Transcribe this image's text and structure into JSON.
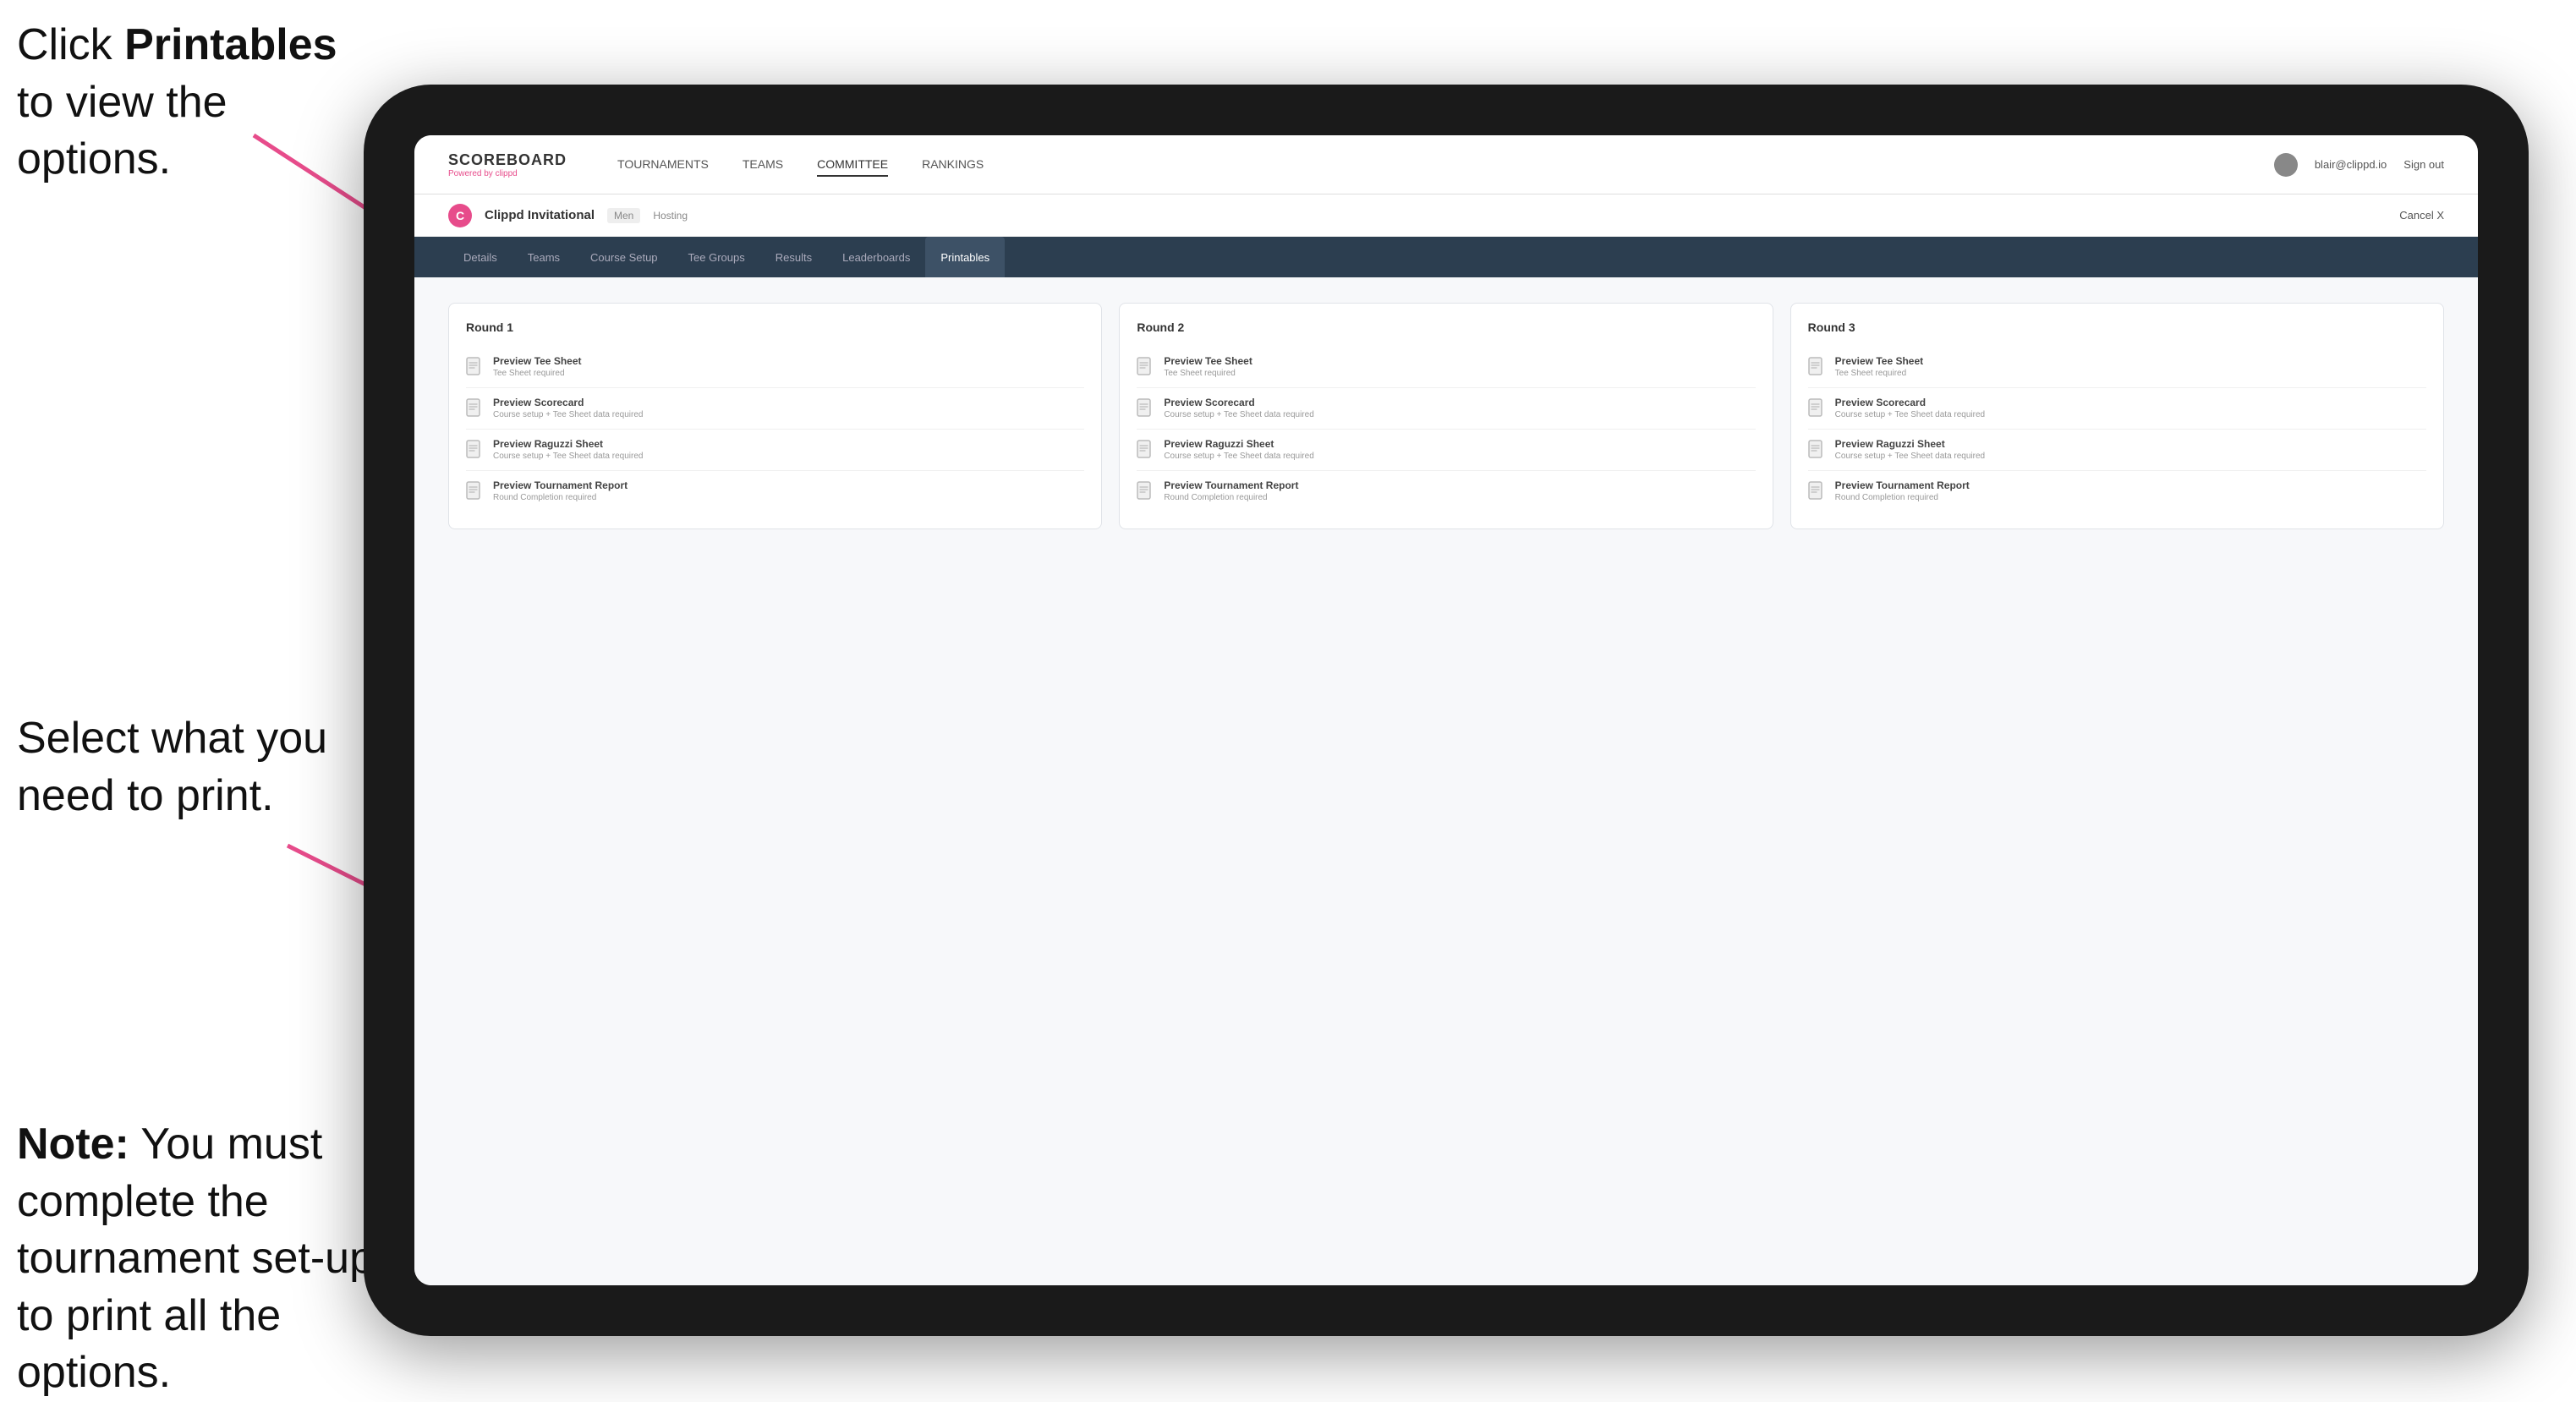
{
  "annotations": {
    "top_text_part1": "Click ",
    "top_text_bold": "Printables",
    "top_text_part2": " to view the options.",
    "middle_text": "Select what you need to print.",
    "bottom_text_bold": "Note:",
    "bottom_text": " You must complete the tournament set-up to print all the options."
  },
  "top_nav": {
    "logo_title": "SCOREBOARD",
    "logo_sub": "Powered by clippd",
    "items": [
      {
        "label": "TOURNAMENTS",
        "active": false
      },
      {
        "label": "TEAMS",
        "active": false
      },
      {
        "label": "COMMITTEE",
        "active": true
      },
      {
        "label": "RANKINGS",
        "active": false
      }
    ],
    "user_email": "blair@clippd.io",
    "sign_out": "Sign out"
  },
  "tournament_header": {
    "logo_letter": "C",
    "name": "Clippd Invitational",
    "badge": "Men",
    "status": "Hosting",
    "cancel": "Cancel X"
  },
  "sub_nav": {
    "items": [
      {
        "label": "Details",
        "active": false
      },
      {
        "label": "Teams",
        "active": false
      },
      {
        "label": "Course Setup",
        "active": false
      },
      {
        "label": "Tee Groups",
        "active": false
      },
      {
        "label": "Results",
        "active": false
      },
      {
        "label": "Leaderboards",
        "active": false
      },
      {
        "label": "Printables",
        "active": true
      }
    ]
  },
  "rounds": [
    {
      "title": "Round 1",
      "items": [
        {
          "title": "Preview Tee Sheet",
          "sub": "Tee Sheet required"
        },
        {
          "title": "Preview Scorecard",
          "sub": "Course setup + Tee Sheet data required"
        },
        {
          "title": "Preview Raguzzi Sheet",
          "sub": "Course setup + Tee Sheet data required"
        },
        {
          "title": "Preview Tournament Report",
          "sub": "Round Completion required"
        }
      ]
    },
    {
      "title": "Round 2",
      "items": [
        {
          "title": "Preview Tee Sheet",
          "sub": "Tee Sheet required"
        },
        {
          "title": "Preview Scorecard",
          "sub": "Course setup + Tee Sheet data required"
        },
        {
          "title": "Preview Raguzzi Sheet",
          "sub": "Course setup + Tee Sheet data required"
        },
        {
          "title": "Preview Tournament Report",
          "sub": "Round Completion required"
        }
      ]
    },
    {
      "title": "Round 3",
      "items": [
        {
          "title": "Preview Tee Sheet",
          "sub": "Tee Sheet required"
        },
        {
          "title": "Preview Scorecard",
          "sub": "Course setup + Tee Sheet data required"
        },
        {
          "title": "Preview Raguzzi Sheet",
          "sub": "Course setup + Tee Sheet data required"
        },
        {
          "title": "Preview Tournament Report",
          "sub": "Round Completion required"
        }
      ]
    }
  ]
}
